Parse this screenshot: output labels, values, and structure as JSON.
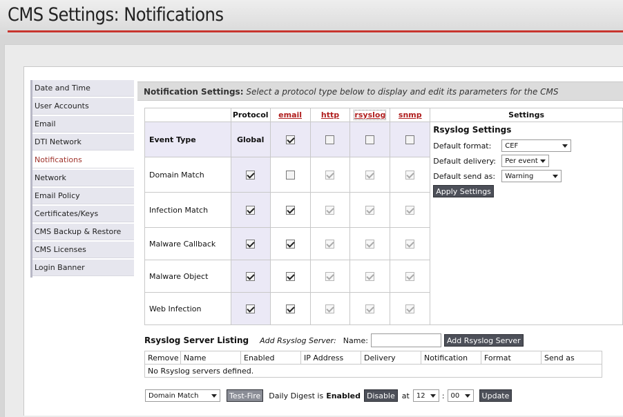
{
  "header": {
    "title": "CMS Settings: Notifications"
  },
  "sidebar": {
    "items": [
      {
        "label": "Date and Time"
      },
      {
        "label": "User Accounts"
      },
      {
        "label": "Email"
      },
      {
        "label": "DTI Network"
      },
      {
        "label": "Notifications",
        "active": true
      },
      {
        "label": "Network"
      },
      {
        "label": "Email Policy"
      },
      {
        "label": "Certificates/Keys"
      },
      {
        "label": "CMS Backup & Restore"
      },
      {
        "label": "CMS Licenses"
      },
      {
        "label": "Login Banner"
      }
    ]
  },
  "notification": {
    "heading": "Notification Settings:",
    "subtitle": "Select a protocol type below to display and edit its parameters for the CMS"
  },
  "grid": {
    "protocol_header": "Protocol",
    "settings_header": "Settings",
    "protocols": [
      "email",
      "http",
      "rsyslog",
      "snmp"
    ],
    "event_type_label": "Event Type",
    "global_label": "Global",
    "global_row": [
      true,
      false,
      false,
      false
    ],
    "rows": [
      {
        "label": "Domain Match",
        "protocol": true,
        "email": false,
        "http": true,
        "rsyslog": true,
        "snmp": true
      },
      {
        "label": "Infection Match",
        "protocol": true,
        "email": true,
        "http": true,
        "rsyslog": true,
        "snmp": true
      },
      {
        "label": "Malware Callback",
        "protocol": true,
        "email": true,
        "http": true,
        "rsyslog": true,
        "snmp": true
      },
      {
        "label": "Malware Object",
        "protocol": true,
        "email": true,
        "http": true,
        "rsyslog": true,
        "snmp": true
      },
      {
        "label": "Web Infection",
        "protocol": true,
        "email": true,
        "http": true,
        "rsyslog": true,
        "snmp": true
      }
    ]
  },
  "rsyslog_settings": {
    "title": "Rsyslog Settings",
    "format_label": "Default format:",
    "format_value": "CEF",
    "delivery_label": "Default delivery:",
    "delivery_value": "Per event",
    "send_as_label": "Default send as:",
    "send_as_value": "Warning",
    "apply_label": "Apply Settings"
  },
  "server_listing": {
    "title": "Rsyslog Server Listing",
    "add_label": "Add Rsyslog Server:",
    "name_label": "Name:",
    "name_value": "",
    "add_button": "Add Rsyslog Server",
    "columns": [
      "Remove",
      "Name",
      "Enabled",
      "IP Address",
      "Delivery",
      "Notification",
      "Format",
      "Send as"
    ],
    "empty_text": "No Rsyslog servers defined."
  },
  "bottom": {
    "event_select": "Domain Match",
    "test_fire": "Test-Fire",
    "digest_label": "Daily Digest is",
    "digest_state": "Enabled",
    "disable_button": "Disable",
    "at_label": "at",
    "hour": "12",
    "colon": ":",
    "minute": "00",
    "update_button": "Update"
  },
  "colors": {
    "accent_red": "#c8352e",
    "link_red": "#b01e1e",
    "button": "#4d5059",
    "highlight_col": "#ebe9f6"
  }
}
